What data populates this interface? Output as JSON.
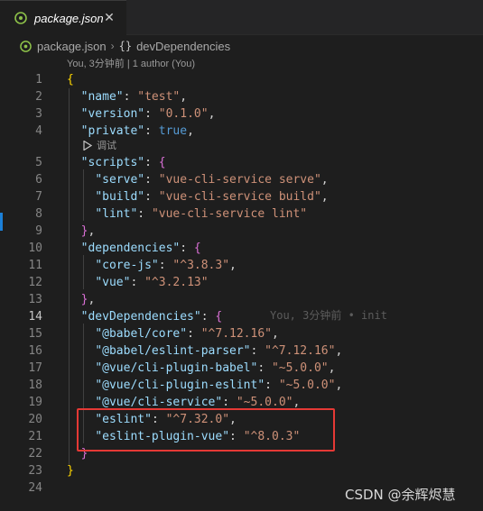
{
  "tab": {
    "label": "package.json",
    "close": "✕",
    "icon": "json-file-icon"
  },
  "breadcrumb": {
    "file": "package.json",
    "sep": "›",
    "braces": "{}",
    "symbol": "devDependencies"
  },
  "codelens": {
    "author": "You, 3分钟前 | 1 author (You)",
    "debug": "调试"
  },
  "blame": "You, 3分钟前 • init",
  "active_line": 14,
  "lines": [
    {
      "n": "1",
      "tokens": [
        {
          "t": "{",
          "c": "tk-brace"
        }
      ]
    },
    {
      "n": "2",
      "tokens": [
        {
          "t": "  "
        },
        {
          "t": "\"name\"",
          "c": "tk-key"
        },
        {
          "t": ": ",
          "c": "tk-punc"
        },
        {
          "t": "\"test\"",
          "c": "tk-str"
        },
        {
          "t": ",",
          "c": "tk-punc"
        }
      ]
    },
    {
      "n": "3",
      "tokens": [
        {
          "t": "  "
        },
        {
          "t": "\"version\"",
          "c": "tk-key"
        },
        {
          "t": ": ",
          "c": "tk-punc"
        },
        {
          "t": "\"0.1.0\"",
          "c": "tk-str"
        },
        {
          "t": ",",
          "c": "tk-punc"
        }
      ]
    },
    {
      "n": "4",
      "tokens": [
        {
          "t": "  "
        },
        {
          "t": "\"private\"",
          "c": "tk-key"
        },
        {
          "t": ": ",
          "c": "tk-punc"
        },
        {
          "t": "true",
          "c": "tk-kw"
        },
        {
          "t": ",",
          "c": "tk-punc"
        }
      ]
    },
    {
      "n": "5",
      "tokens": [
        {
          "t": "  "
        },
        {
          "t": "\"scripts\"",
          "c": "tk-key"
        },
        {
          "t": ": ",
          "c": "tk-punc"
        },
        {
          "t": "{",
          "c": "tk-brace2"
        }
      ]
    },
    {
      "n": "6",
      "tokens": [
        {
          "t": "    "
        },
        {
          "t": "\"serve\"",
          "c": "tk-key"
        },
        {
          "t": ": ",
          "c": "tk-punc"
        },
        {
          "t": "\"vue-cli-service serve\"",
          "c": "tk-str"
        },
        {
          "t": ",",
          "c": "tk-punc"
        }
      ]
    },
    {
      "n": "7",
      "tokens": [
        {
          "t": "    "
        },
        {
          "t": "\"build\"",
          "c": "tk-key"
        },
        {
          "t": ": ",
          "c": "tk-punc"
        },
        {
          "t": "\"vue-cli-service build\"",
          "c": "tk-str"
        },
        {
          "t": ",",
          "c": "tk-punc"
        }
      ]
    },
    {
      "n": "8",
      "tokens": [
        {
          "t": "    "
        },
        {
          "t": "\"lint\"",
          "c": "tk-key"
        },
        {
          "t": ": ",
          "c": "tk-punc"
        },
        {
          "t": "\"vue-cli-service lint\"",
          "c": "tk-str"
        }
      ]
    },
    {
      "n": "9",
      "tokens": [
        {
          "t": "  "
        },
        {
          "t": "}",
          "c": "tk-brace2"
        },
        {
          "t": ",",
          "c": "tk-punc"
        }
      ]
    },
    {
      "n": "10",
      "tokens": [
        {
          "t": "  "
        },
        {
          "t": "\"dependencies\"",
          "c": "tk-key"
        },
        {
          "t": ": ",
          "c": "tk-punc"
        },
        {
          "t": "{",
          "c": "tk-brace2"
        }
      ]
    },
    {
      "n": "11",
      "tokens": [
        {
          "t": "    "
        },
        {
          "t": "\"core-js\"",
          "c": "tk-key"
        },
        {
          "t": ": ",
          "c": "tk-punc"
        },
        {
          "t": "\"^3.8.3\"",
          "c": "tk-str"
        },
        {
          "t": ",",
          "c": "tk-punc"
        }
      ]
    },
    {
      "n": "12",
      "tokens": [
        {
          "t": "    "
        },
        {
          "t": "\"vue\"",
          "c": "tk-key"
        },
        {
          "t": ": ",
          "c": "tk-punc"
        },
        {
          "t": "\"^3.2.13\"",
          "c": "tk-str"
        }
      ]
    },
    {
      "n": "13",
      "tokens": [
        {
          "t": "  "
        },
        {
          "t": "}",
          "c": "tk-brace2"
        },
        {
          "t": ",",
          "c": "tk-punc"
        }
      ]
    },
    {
      "n": "14",
      "tokens": [
        {
          "t": "  "
        },
        {
          "t": "\"devDependencies\"",
          "c": "tk-key"
        },
        {
          "t": ": ",
          "c": "tk-punc"
        },
        {
          "t": "{",
          "c": "tk-brace2"
        }
      ]
    },
    {
      "n": "15",
      "tokens": [
        {
          "t": "    "
        },
        {
          "t": "\"@babel/core\"",
          "c": "tk-key"
        },
        {
          "t": ": ",
          "c": "tk-punc"
        },
        {
          "t": "\"^7.12.16\"",
          "c": "tk-str"
        },
        {
          "t": ",",
          "c": "tk-punc"
        }
      ]
    },
    {
      "n": "16",
      "tokens": [
        {
          "t": "    "
        },
        {
          "t": "\"@babel/eslint-parser\"",
          "c": "tk-key"
        },
        {
          "t": ": ",
          "c": "tk-punc"
        },
        {
          "t": "\"^7.12.16\"",
          "c": "tk-str"
        },
        {
          "t": ",",
          "c": "tk-punc"
        }
      ]
    },
    {
      "n": "17",
      "tokens": [
        {
          "t": "    "
        },
        {
          "t": "\"@vue/cli-plugin-babel\"",
          "c": "tk-key"
        },
        {
          "t": ": ",
          "c": "tk-punc"
        },
        {
          "t": "\"~5.0.0\"",
          "c": "tk-str"
        },
        {
          "t": ",",
          "c": "tk-punc"
        }
      ]
    },
    {
      "n": "18",
      "tokens": [
        {
          "t": "    "
        },
        {
          "t": "\"@vue/cli-plugin-eslint\"",
          "c": "tk-key"
        },
        {
          "t": ": ",
          "c": "tk-punc"
        },
        {
          "t": "\"~5.0.0\"",
          "c": "tk-str"
        },
        {
          "t": ",",
          "c": "tk-punc"
        }
      ]
    },
    {
      "n": "19",
      "tokens": [
        {
          "t": "    "
        },
        {
          "t": "\"@vue/cli-service\"",
          "c": "tk-key"
        },
        {
          "t": ": ",
          "c": "tk-punc"
        },
        {
          "t": "\"~5.0.0\"",
          "c": "tk-str"
        },
        {
          "t": ",",
          "c": "tk-punc"
        }
      ]
    },
    {
      "n": "20",
      "tokens": [
        {
          "t": "    "
        },
        {
          "t": "\"eslint\"",
          "c": "tk-key"
        },
        {
          "t": ": ",
          "c": "tk-punc"
        },
        {
          "t": "\"^7.32.0\"",
          "c": "tk-str"
        },
        {
          "t": ",",
          "c": "tk-punc"
        }
      ]
    },
    {
      "n": "21",
      "tokens": [
        {
          "t": "    "
        },
        {
          "t": "\"eslint-plugin-vue\"",
          "c": "tk-key"
        },
        {
          "t": ": ",
          "c": "tk-punc"
        },
        {
          "t": "\"^8.0.3\"",
          "c": "tk-str"
        }
      ]
    },
    {
      "n": "22",
      "tokens": [
        {
          "t": "  "
        },
        {
          "t": "}",
          "c": "tk-brace2"
        }
      ]
    },
    {
      "n": "23",
      "tokens": [
        {
          "t": "}",
          "c": "tk-brace"
        }
      ]
    },
    {
      "n": "24",
      "tokens": []
    }
  ],
  "watermark": "CSDN @余辉烬慧",
  "colors": {
    "background": "#1e1e1e",
    "key": "#9cdcfe",
    "string": "#ce9178",
    "keyword": "#569cd6",
    "highlight_box": "#e53935"
  }
}
